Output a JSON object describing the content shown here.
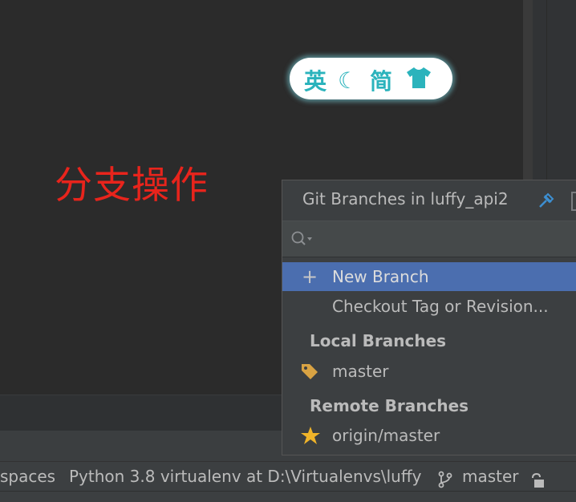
{
  "overlay": {
    "title": "分支操作",
    "pill": {
      "english_label": "英",
      "moon_glyph": "☾",
      "simplified_label": "简"
    }
  },
  "git_branches_popup": {
    "title": "Git Branches in luffy_api2",
    "search_placeholder": "",
    "actions": [
      {
        "label": "New Branch",
        "selected": true
      },
      {
        "label": "Checkout Tag or Revision..."
      }
    ],
    "local_branches": {
      "heading": "Local Branches",
      "items": [
        {
          "label": "master"
        }
      ]
    },
    "remote_branches": {
      "heading": "Remote Branches",
      "items": [
        {
          "label": "origin/master"
        }
      ]
    }
  },
  "status_bar": {
    "indent": "spaces",
    "interpreter": "Python 3.8 virtualenv at D:\\Virtualenvs\\luffy",
    "branch": "master"
  },
  "colors": {
    "accent_selected": "#4b6eaf",
    "title_red": "#e8241c",
    "pill_teal": "#2bb3bc",
    "tag_orange": "#d9a343",
    "star_yellow": "#f0b429"
  },
  "icons": [
    "branch-icon",
    "lock-icon",
    "pin-icon",
    "search-icon",
    "plus-icon",
    "tag-icon",
    "star-icon",
    "moon-icon",
    "shirt-icon"
  ]
}
